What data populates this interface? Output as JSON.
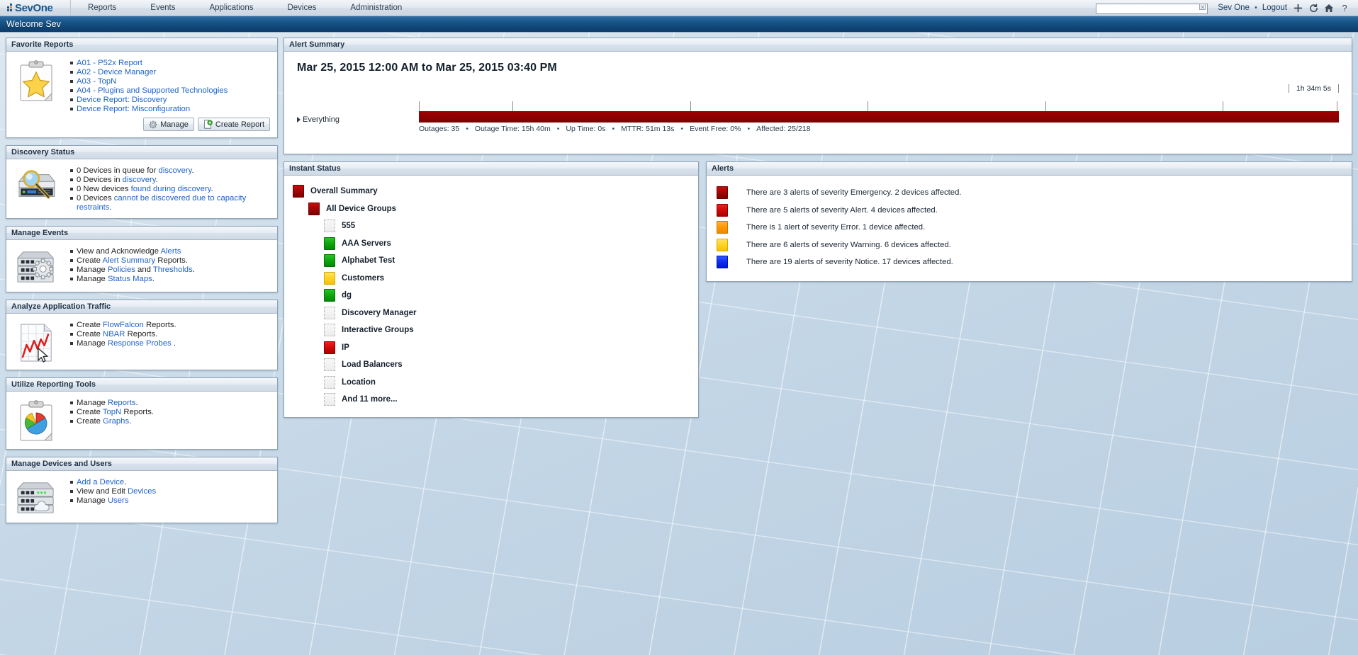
{
  "topnav": {
    "logo_text": "SevOne",
    "items": [
      {
        "label": "Reports"
      },
      {
        "label": "Events"
      },
      {
        "label": "Applications"
      },
      {
        "label": "Devices"
      },
      {
        "label": "Administration"
      }
    ],
    "search": {
      "value": "",
      "placeholder": ""
    },
    "user": "Sev One",
    "separator": "•",
    "logout": "Logout",
    "icons": [
      "plus-icon",
      "refresh-icon",
      "home-icon",
      "help-icon"
    ]
  },
  "welcome": {
    "text": "Welcome Sev"
  },
  "favorite_reports": {
    "title": "Favorite Reports",
    "icon": "clipboard-star-icon",
    "links": [
      "A01 - P52x Report",
      "A02 - Device Manager",
      "A03 - TopN",
      "A04 - Plugins and Supported Technologies",
      "Device Report: Discovery",
      "Device Report: Misconfiguration"
    ],
    "manage_label": "Manage",
    "create_label": "Create Report"
  },
  "discovery_status": {
    "title": "Discovery Status",
    "icon": "server-magnifier-icon",
    "items": [
      {
        "pre": "0 Devices in queue for ",
        "link": "discovery",
        "post": "."
      },
      {
        "pre": "0 Devices in ",
        "link": "discovery",
        "post": "."
      },
      {
        "pre": "0 New devices ",
        "link": "found during discovery",
        "post": "."
      },
      {
        "pre": "0 Devices ",
        "link": "cannot be discovered due to capacity restraints",
        "post": "."
      }
    ]
  },
  "manage_events": {
    "title": "Manage Events",
    "icon": "server-gear-icon",
    "items": [
      {
        "pre": "View and Acknowledge ",
        "link": "Alerts",
        "post": ""
      },
      {
        "pre": "Create ",
        "link": "Alert Summary",
        "post": " Reports."
      },
      {
        "pre": "Manage ",
        "link": "Policies",
        "mid": " and ",
        "link2": "Thresholds",
        "post": "."
      },
      {
        "pre": "Manage ",
        "link": "Status Maps",
        "post": "."
      }
    ]
  },
  "analyze_traffic": {
    "title": "Analyze Application Traffic",
    "icon": "chart-cursor-icon",
    "items": [
      {
        "pre": "Create ",
        "link": "FlowFalcon",
        "post": " Reports."
      },
      {
        "pre": "Create ",
        "link": "NBAR",
        "post": " Reports."
      },
      {
        "pre": "Manage ",
        "link": "Response Probes",
        "post": " ."
      }
    ]
  },
  "reporting_tools": {
    "title": "Utilize Reporting Tools",
    "icon": "clipboard-pie-icon",
    "items": [
      {
        "pre": "Manage ",
        "link": "Reports",
        "post": "."
      },
      {
        "pre": "Create ",
        "link": "TopN",
        "post": " Reports."
      },
      {
        "pre": "Create ",
        "link": "Graphs",
        "post": "."
      }
    ]
  },
  "devices_users": {
    "title": "Manage Devices and Users",
    "icon": "server-cloud-icon",
    "items": [
      {
        "pre": "",
        "link": "Add a Device",
        "post": "."
      },
      {
        "pre": "View and Edit ",
        "link": "Devices",
        "post": ""
      },
      {
        "pre": "Manage ",
        "link": "Users",
        "post": ""
      }
    ]
  },
  "alert_summary": {
    "title": "Alert Summary",
    "range_title": "Mar 25, 2015 12:00 AM to Mar 25, 2015 03:40 PM",
    "row_label": "Everything",
    "duration_label": "1h 34m 5s",
    "bar_color": "#8e0101",
    "tick_count": 7,
    "stats": [
      {
        "label": "Outages",
        "value": "35",
        "text": "Outages: 35"
      },
      {
        "label": "Outage Time",
        "value": "15h 40m",
        "text": "Outage Time: 15h 40m"
      },
      {
        "label": "Up Time",
        "value": "0s",
        "text": "Up Time: 0s"
      },
      {
        "label": "MTTR",
        "value": "51m 13s",
        "text": "MTTR: 51m 13s"
      },
      {
        "label": "Event Free",
        "value": "0%",
        "text": "Event Free: 0%"
      },
      {
        "label": "Affected",
        "value": "25/218",
        "text": "Affected: 25/218"
      }
    ],
    "separator": "•"
  },
  "instant_status": {
    "title": "Instant Status",
    "rows": [
      {
        "label": "Overall Summary",
        "status": "red",
        "indent": 0
      },
      {
        "label": "All Device Groups",
        "status": "red",
        "indent": 1
      },
      {
        "label": "555",
        "status": "empty",
        "indent": 2
      },
      {
        "label": "AAA Servers",
        "status": "green",
        "indent": 2
      },
      {
        "label": "Alphabet Test",
        "status": "green",
        "indent": 2
      },
      {
        "label": "Customers",
        "status": "yellow",
        "indent": 2
      },
      {
        "label": "dg",
        "status": "green",
        "indent": 2
      },
      {
        "label": "Discovery Manager",
        "status": "empty",
        "indent": 2
      },
      {
        "label": "Interactive Groups",
        "status": "empty",
        "indent": 2
      },
      {
        "label": "IP",
        "status": "red2",
        "indent": 2
      },
      {
        "label": "Load Balancers",
        "status": "empty",
        "indent": 2
      },
      {
        "label": "Location",
        "status": "empty",
        "indent": 2
      },
      {
        "label": "And 11 more...",
        "status": "empty",
        "indent": 2
      }
    ]
  },
  "alerts": {
    "title": "Alerts",
    "rows": [
      {
        "severity": "Emergency",
        "status": "red",
        "text": "There are 3 alerts of severity Emergency. 2 devices affected."
      },
      {
        "severity": "Alert",
        "status": "red2",
        "text": "There are 5 alerts of severity Alert. 4 devices affected."
      },
      {
        "severity": "Error",
        "status": "orange",
        "text": "There is 1 alert of severity Error. 1 device affected."
      },
      {
        "severity": "Warning",
        "status": "yellow",
        "text": "There are 6 alerts of severity Warning. 6 devices affected."
      },
      {
        "severity": "Notice",
        "status": "blue",
        "text": "There are 19 alerts of severity Notice. 17 devices affected."
      }
    ]
  },
  "colors": {
    "brand_blue": "#17568f",
    "brand_orange": "#f0820a",
    "welcome_bar": "#0f4475",
    "link": "#1e63c6",
    "status_red": "#a50707",
    "status_red_bright": "#d40a0a",
    "status_green": "#0faa0f",
    "status_yellow": "#ffd428",
    "status_orange": "#ff9908",
    "status_blue": "#1030f0"
  }
}
